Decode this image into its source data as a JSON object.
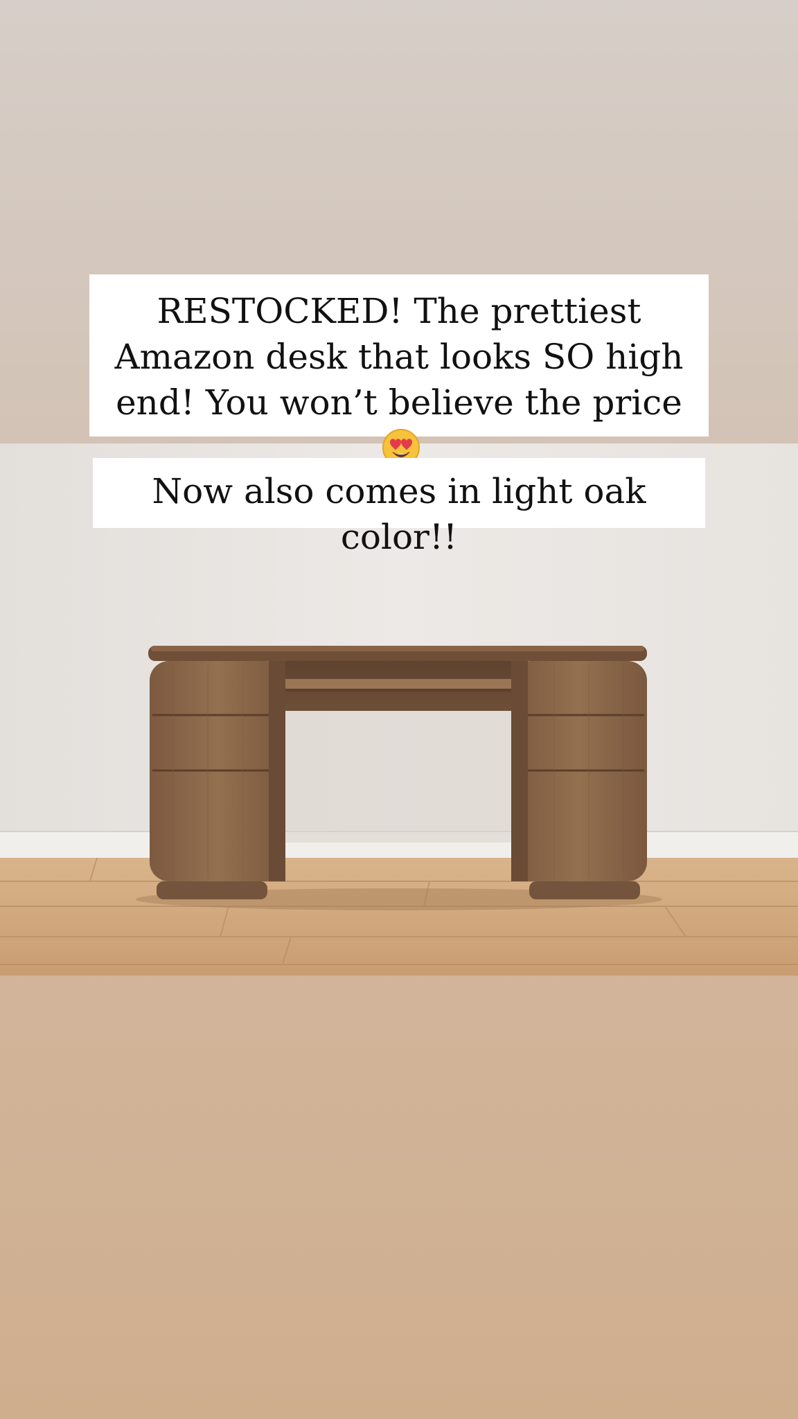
{
  "story": {
    "caption_main": "RESTOCKED! The prettiest Amazon desk that looks SO high end! You won’t believe the price",
    "caption_emoji_icon": "heart-eyes-emoji",
    "caption_sub": "Now also comes in light oak color!!"
  },
  "colors": {
    "background_top": "#d6cec8",
    "background_bottom": "#cfae8e",
    "caption_background": "#ffffff",
    "caption_text": "#111111",
    "desk_wood": "#8a6448",
    "floor_wood": "#cfa67c",
    "wall": "#e9e5e1"
  }
}
